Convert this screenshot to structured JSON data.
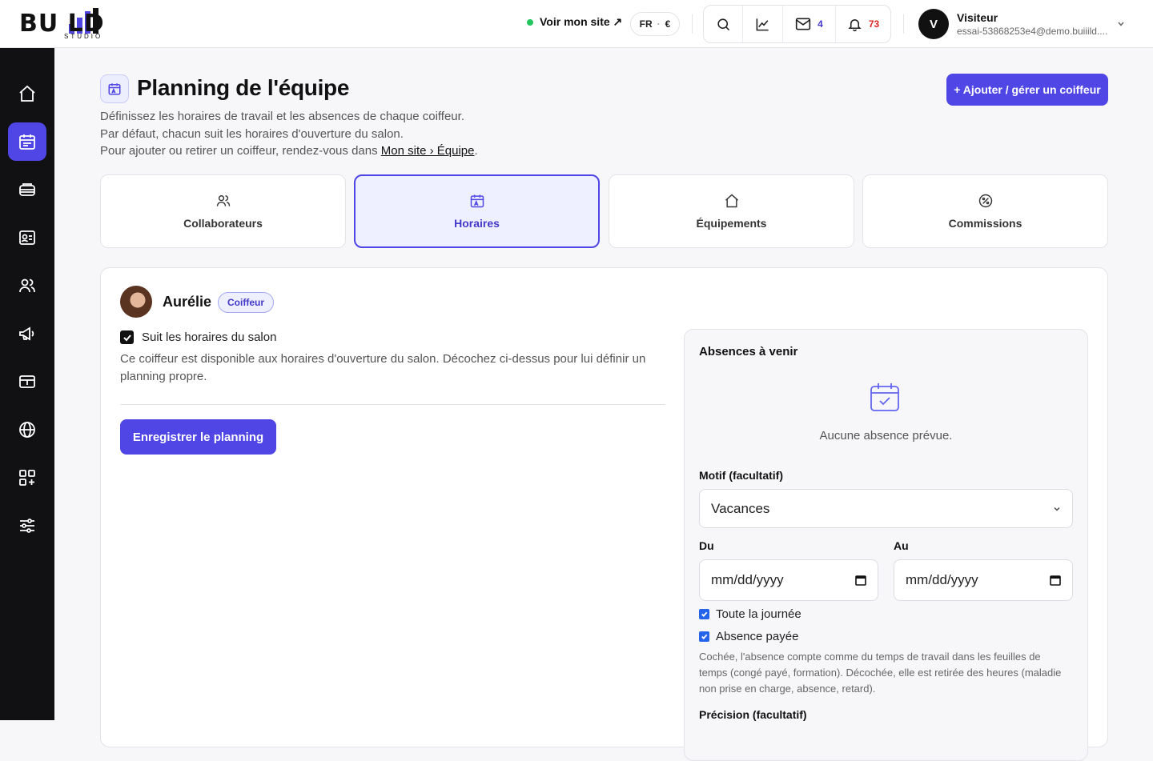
{
  "app": {
    "logo_text": "BU LD",
    "logo_sub": "STUDIO"
  },
  "topbar": {
    "site_link": "Voir mon site ↗",
    "lang": "FR",
    "currency": "€",
    "messages_count": "4",
    "notifications_count": "73",
    "user_initial": "V",
    "user_name": "Visiteur",
    "user_email": "essai-53868253e4@demo.buiiild...."
  },
  "page": {
    "title": "Planning de l'équipe",
    "desc_line1": "Définissez les horaires de travail et les absences de chaque coiffeur.",
    "desc_line2": "Par défaut, chacun suit les horaires d'ouverture du salon.",
    "desc_line3": "Pour ajouter ou retirer un coiffeur, rendez-vous dans ",
    "desc_link": "Mon site › Équipe",
    "desc_end": ".",
    "add_button": "+ Ajouter / gérer un coiffeur"
  },
  "tabs": [
    {
      "label": "Collaborateurs",
      "icon": "users-icon"
    },
    {
      "label": "Horaires",
      "icon": "calendar-icon",
      "active": true
    },
    {
      "label": "Équipements",
      "icon": "home-icon"
    },
    {
      "label": "Commissions",
      "icon": "percent-icon"
    }
  ],
  "employee": {
    "name": "Aurélie",
    "role": "Coiffeur",
    "follows_label": "Suit les horaires du salon",
    "follows_checked": true,
    "follows_help": "Ce coiffeur est disponible aux horaires d'ouverture du salon. Décochez ci-dessus pour lui définir un planning propre.",
    "save_button": "Enregistrer le planning"
  },
  "absences": {
    "title": "Absences à venir",
    "empty_text": "Aucune absence prévue.",
    "motif_label": "Motif (facultatif)",
    "motif_value": "Vacances",
    "from_label": "Du",
    "from_value": "mm/dd/yyyy",
    "to_label": "Au",
    "to_value": "mm/dd/yyyy",
    "all_day_label": "Toute la journée",
    "all_day_checked": true,
    "paid_label": "Absence payée",
    "paid_checked": true,
    "paid_help": "Cochée, l'absence compte comme du temps de travail dans les feuilles de temps (congé payé, formation). Décochée, elle est retirée des heures (maladie non prise en charge, absence, retard).",
    "precision_label": "Précision (facultatif)"
  },
  "colors": {
    "accent": "#4f46e5",
    "sidebar_bg": "#111114",
    "online": "#22c55e",
    "alert": "#dc2626"
  }
}
